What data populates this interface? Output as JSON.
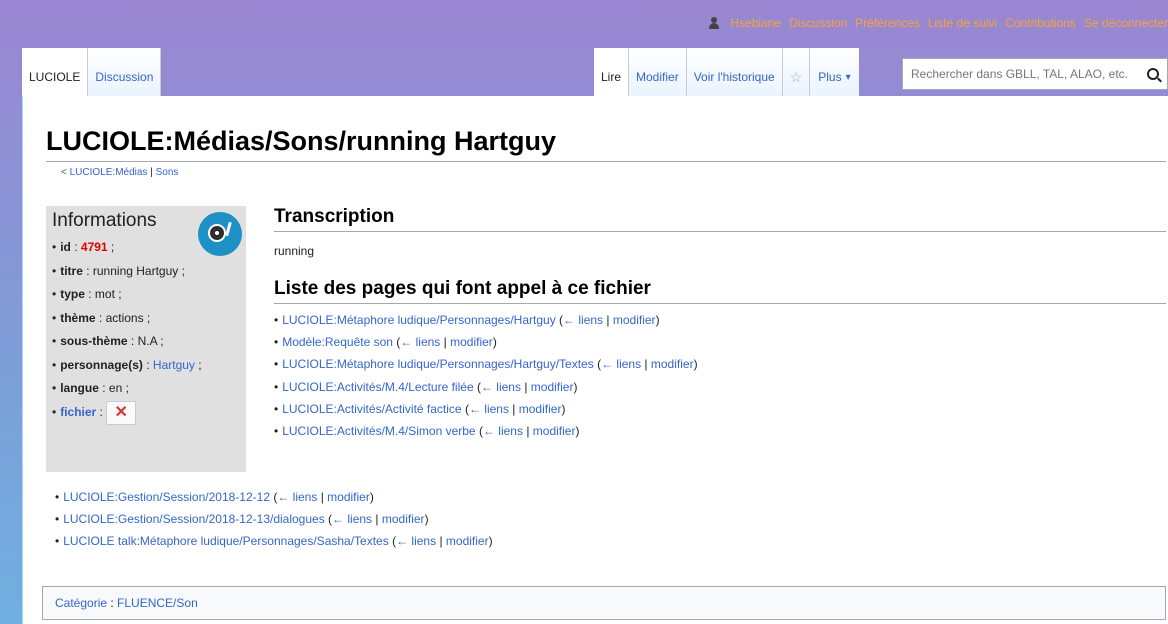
{
  "personal": {
    "username": "Hsebiane",
    "items": [
      "Discussion",
      "Préférences",
      "Liste de suivi",
      "Contributions",
      "Se déconnecter"
    ]
  },
  "tabs": {
    "left": [
      {
        "label": "LUCIOLE",
        "selected": true
      },
      {
        "label": "Discussion",
        "selected": false
      }
    ],
    "right": [
      {
        "label": "Lire",
        "selected": true
      },
      {
        "label": "Modifier",
        "selected": false
      },
      {
        "label": "Voir l'historique",
        "selected": false
      }
    ],
    "more": "Plus"
  },
  "search": {
    "placeholder": "Rechercher dans GBLL, TAL, ALAO, etc."
  },
  "page": {
    "title": "LUCIOLE:Médias/Sons/running Hartguy",
    "subpages": {
      "prefix": "< ",
      "link1": "LUCIOLE:Médias",
      "sep": " | ",
      "link2": "Sons"
    }
  },
  "infobox": {
    "title": "Informations",
    "fields": [
      {
        "key": "id",
        "value": "4791"
      },
      {
        "key": "titre",
        "value": "running Hartguy"
      },
      {
        "key": "type",
        "value": "mot"
      },
      {
        "key": "thème",
        "value": "actions"
      },
      {
        "key": "sous-thème",
        "value": "N.A"
      },
      {
        "key": "personnage(s)",
        "value": "Hartguy"
      },
      {
        "key": "langue",
        "value": "en"
      },
      {
        "key": "fichier",
        "value": ""
      }
    ]
  },
  "transcription": {
    "heading": "Transcription",
    "text": "running"
  },
  "usage": {
    "heading": "Liste des pages qui font appel à ce fichier",
    "links_label": "← liens",
    "edit_label": "modifier",
    "pages_first": [
      "LUCIOLE:Métaphore ludique/Personnages/Hartguy",
      "Modèle:Requête son",
      "LUCIOLE:Métaphore ludique/Personnages/Hartguy/Textes",
      "LUCIOLE:Activités/M.4/Lecture filée",
      "LUCIOLE:Activités/Activité factice",
      "LUCIOLE:Activités/M.4/Simon verbe"
    ],
    "pages_second": [
      "LUCIOLE:Gestion/Session/2018-12-12",
      "LUCIOLE:Gestion/Session/2018-12-13/dialogues",
      "LUCIOLE talk:Métaphore ludique/Personnages/Sasha/Textes"
    ]
  },
  "categories": {
    "label": "Catégorie",
    "items": [
      "FLUENCE/Son"
    ]
  },
  "colors": {
    "link": "#3366cc",
    "personal": "#f7a33a",
    "id_red": "#dd0000"
  }
}
